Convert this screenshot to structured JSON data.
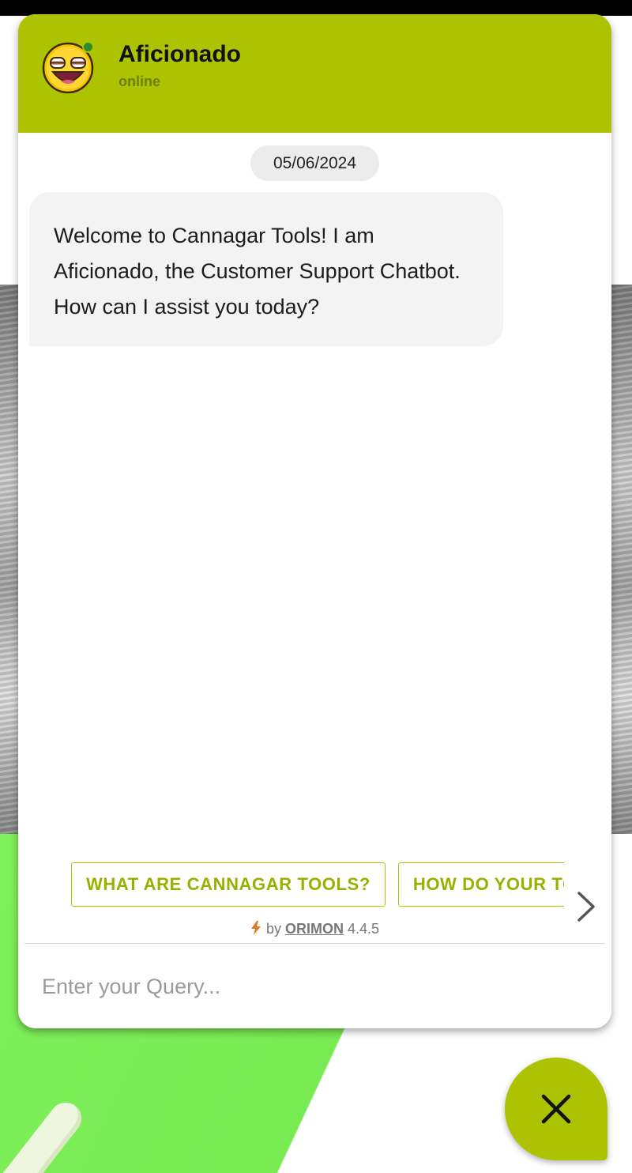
{
  "background": {
    "page_colors": {
      "top_bar": "#000000",
      "green_panel": "#7ef05a"
    }
  },
  "colors": {
    "accent": "#adc302",
    "accent_text": "#9ab000",
    "online": "#2e8b2e",
    "bubble_bg": "#f3f3f3"
  },
  "header": {
    "avatar_icon": "laughing-face-icon",
    "bot_name": "Aficionado",
    "status": "online"
  },
  "conversation": {
    "date": "05/06/2024",
    "messages": [
      {
        "sender": "bot",
        "text": "Welcome to Cannagar Tools! I am Aficionado, the Customer Support Chatbot. How can I assist you today?"
      }
    ]
  },
  "suggestions": {
    "items": [
      {
        "label": "WHAT ARE CANNAGAR TOOLS?"
      },
      {
        "label": "HOW DO YOUR TOOLS WORK?"
      }
    ],
    "next_icon": "chevron-right-icon"
  },
  "footer": {
    "powered_icon": "bolt-icon",
    "by_text": "by",
    "brand": "ORIMON",
    "version": "4.4.5"
  },
  "input": {
    "placeholder": "Enter your Query...",
    "value": ""
  },
  "launcher": {
    "icon": "close-icon"
  }
}
